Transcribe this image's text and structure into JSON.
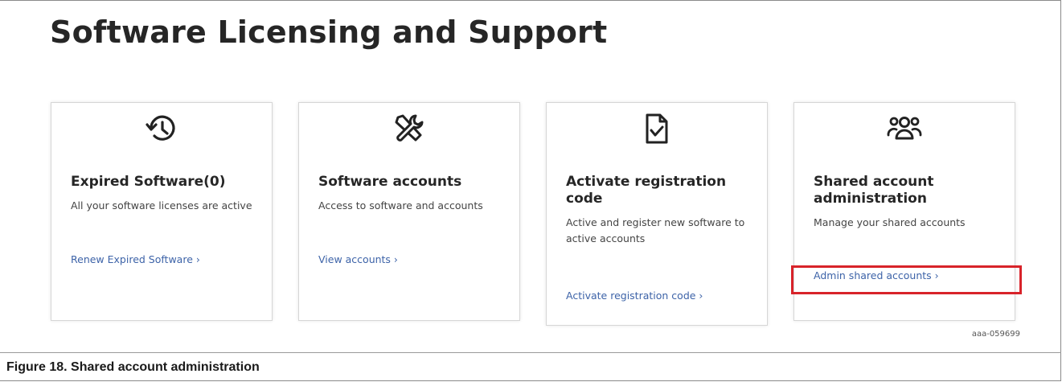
{
  "page": {
    "title": "Software Licensing and Support"
  },
  "cards": [
    {
      "icon": "history-icon",
      "title": "Expired Software(0)",
      "description": "All your software licenses are active",
      "link": "Renew Expired Software ›"
    },
    {
      "icon": "tools-icon",
      "title": "Software accounts",
      "description": "Access to software and accounts",
      "link": "View accounts ›"
    },
    {
      "icon": "document-check-icon",
      "title": "Activate registration code",
      "description": "Active and register new software to active accounts",
      "link": "Activate registration code ›"
    },
    {
      "icon": "users-group-icon",
      "title": "Shared account administration",
      "description": "Manage your shared accounts",
      "link": "Admin shared accounts ›"
    }
  ],
  "colors": {
    "link": "#3d63a8",
    "highlight": "#d8232a",
    "title": "#262626"
  },
  "figure": {
    "code": "aaa-059699",
    "caption": "Figure 18.  Shared account administration"
  }
}
